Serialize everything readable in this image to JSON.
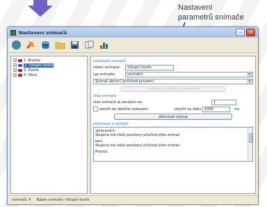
{
  "callout": {
    "line1": "Nastavení",
    "line2": "parametrů snímače"
  },
  "window": {
    "title": "Nastavení snímačů",
    "minimize": "–",
    "close": "✕"
  },
  "toolbar": {
    "icons": [
      "globe-icon",
      "tools-icon",
      "database-icon",
      "folder-icon",
      "save-icon",
      "copy-icon",
      "chart-icon"
    ]
  },
  "tree": {
    "items": [
      {
        "label": "1. Branka",
        "selected": false
      },
      {
        "label": "2. Vstupní dveře",
        "selected": true
      },
      {
        "label": "3. Dvere",
        "selected": false
      },
      {
        "label": "4. Okno",
        "selected": false
      }
    ]
  },
  "panel": {
    "section1_title": "nastavení snímačů",
    "name_label": "název snímače:",
    "name_value": "Vstupní dveře",
    "type_label": "typ snímače:",
    "type_value": "normální",
    "mode_value": "Snímač aktivní (průchod povolen)",
    "disabled_button": "nastavení rozšířených parametrů",
    "section2_title": "stav snímače",
    "state_label": "stav snímače je označen na:",
    "state_value": "1",
    "checkbox_label": "otevřít do dalšího nastavení",
    "delay_label": "otevřít na dobu",
    "delay_value": "1000",
    "delay_unit": "ms",
    "activate_button": "aktivovat výstup",
    "section3_title": "informace o snímači",
    "log": [
      {
        "head": "zpracování:",
        "body": "Skupina má stále povolený průchod přes snímač"
      },
      {
        "head": "test:",
        "body": "Skupina má stále povolený průchod přes snímač"
      },
      {
        "head": "Provoz:",
        "body": ""
      }
    ]
  },
  "status": {
    "count": "snímačů: 4",
    "name": "Název snímače: Vstupní dveře"
  }
}
